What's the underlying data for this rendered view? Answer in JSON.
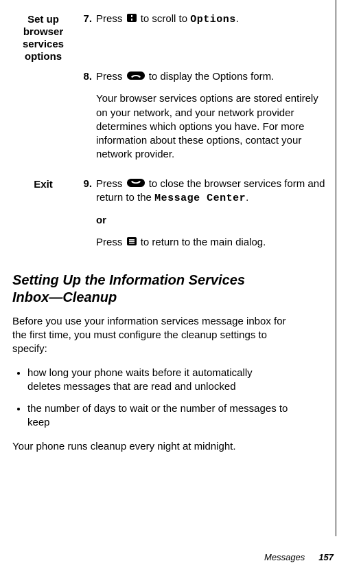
{
  "blocks": [
    {
      "label": [
        "Set up",
        "browser",
        "services",
        "options"
      ],
      "steps": [
        {
          "num": "7.",
          "parts": [
            "Press ",
            " to scroll to ",
            "Options",
            "."
          ]
        },
        {
          "num": "8.",
          "parts": [
            "Press ",
            " to display the Options form."
          ],
          "note": "Your browser services options are stored entirely on your network, and your network provider determines which options you have. For more information about these options, contact your network  provider."
        }
      ]
    },
    {
      "label": [
        "Exit"
      ],
      "steps": [
        {
          "num": "9.",
          "parts": [
            "Press ",
            " to close the browser services form and return to the ",
            "Message Center",
            "."
          ],
          "or": "or",
          "alt": [
            "Press ",
            " to return to the main dialog."
          ]
        }
      ]
    }
  ],
  "section": {
    "title": [
      "Setting Up the Information Services",
      "Inbox—Cleanup"
    ],
    "intro": "Before you use your information services message inbox for the first time, you must configure the cleanup settings to specify:",
    "bullets": [
      "how long your phone waits before it automatically deletes messages that are read and unlocked",
      "the number of days to wait or the number of messages to keep"
    ],
    "closing": "Your phone runs cleanup every night at midnight."
  },
  "footer": {
    "section": "Messages",
    "page": "157"
  }
}
